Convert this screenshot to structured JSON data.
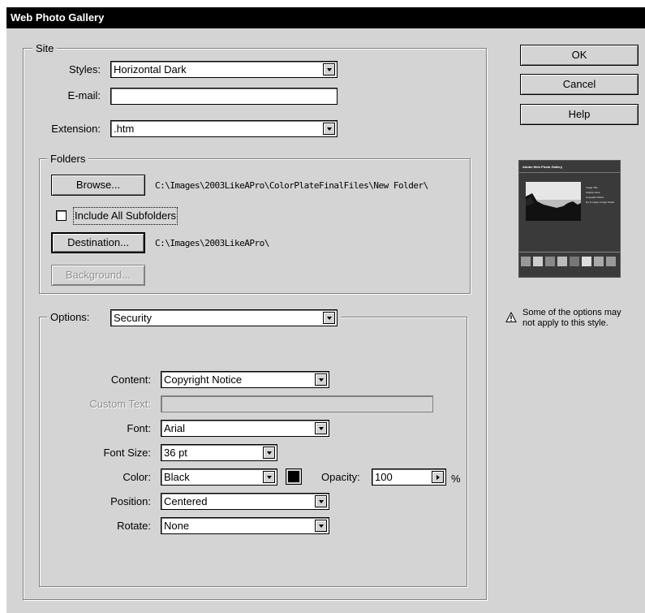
{
  "window": {
    "title": "Web Photo Gallery"
  },
  "site": {
    "legend": "Site",
    "styles_label": "Styles:",
    "styles_value": "Horizontal Dark",
    "email_label": "E-mail:",
    "email_value": "",
    "extension_label": "Extension:",
    "extension_value": ".htm"
  },
  "folders": {
    "legend": "Folders",
    "browse_label": "Browse...",
    "browse_path": "C:\\Images\\2003LikeAPro\\ColorPlateFinalFiles\\New Folder\\",
    "include_subfolders_label": "Include All Subfolders",
    "include_subfolders_checked": false,
    "destination_label": "Destination...",
    "destination_path": "C:\\Images\\2003LikeAPro\\",
    "background_label": "Background..."
  },
  "options": {
    "label": "Options:",
    "value": "Security",
    "content_label": "Content:",
    "content_value": "Copyright Notice",
    "custom_text_label": "Custom Text:",
    "custom_text_value": "",
    "font_label": "Font:",
    "font_value": "Arial",
    "font_size_label": "Font Size:",
    "font_size_value": "36 pt",
    "color_label": "Color:",
    "color_value": "Black",
    "color_swatch": "#000000",
    "opacity_label": "Opacity:",
    "opacity_value": "100",
    "opacity_unit": "%",
    "position_label": "Position:",
    "position_value": "Centered",
    "rotate_label": "Rotate:",
    "rotate_value": "None"
  },
  "buttons": {
    "ok": "OK",
    "cancel": "Cancel",
    "help": "Help"
  },
  "preview": {
    "title": "Adobe Web Photo Gallery",
    "menu": [
      "Image Title",
      "Caption Here",
      "Copyright Notice",
      "Go to Larger Image Folder"
    ]
  },
  "note": {
    "text": "Some of the options may not apply to this style.",
    "icon": "warning-icon"
  },
  "colors": {
    "dialog_bg": "#d4d4d4",
    "title_bg": "#000000",
    "title_fg": "#ffffff"
  }
}
